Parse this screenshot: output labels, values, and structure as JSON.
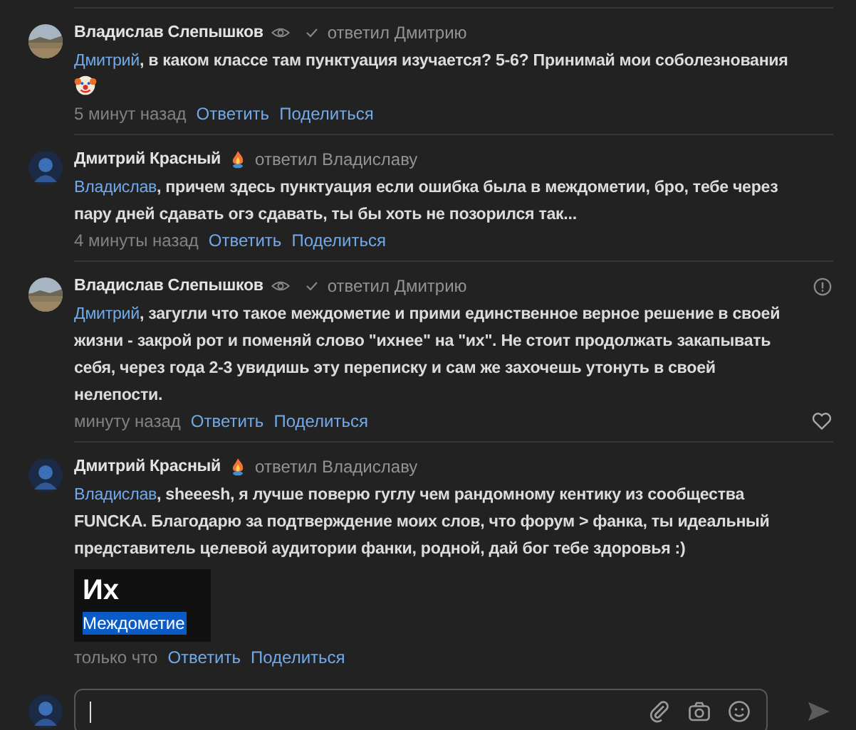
{
  "comments": [
    {
      "author": "Владислав Слепышков",
      "verified": true,
      "reply_to": "ответил Дмитрию",
      "mention": "Дмитрий",
      "text": ", в каком классе там пунктуация изучается? 5-6? Принимай мои соболезнования",
      "emoji": true,
      "time": "5 минут назад",
      "actions": [
        "Ответить",
        "Поделиться"
      ],
      "report": false,
      "like": false
    },
    {
      "author": "Дмитрий Красный",
      "verified": false,
      "reply_to": "ответил Владиславу",
      "mention": "Владислав",
      "text": ", причем здесь пунктуация если ошибка была в междометии, бро, тебе через пару дней сдавать огэ сдавать, ты бы хоть не позорился так...",
      "emoji": false,
      "time": "4 минуты назад",
      "actions": [
        "Ответить",
        "Поделиться"
      ],
      "report": false,
      "like": false
    },
    {
      "author": "Владислав Слепышков",
      "verified": true,
      "reply_to": "ответил Дмитрию",
      "mention": "Дмитрий",
      "text": ", загугли что такое междометие и прими единственное верное решение в своей жизни - закрой рот и поменяй слово \"ихнее\" на \"их\". Не стоит продолжать закапывать себя, через года 2-3 увидишь эту переписку и сам же захочешь утонуть в своей нелепости.",
      "emoji": false,
      "time": "минуту назад",
      "actions": [
        "Ответить",
        "Поделиться"
      ],
      "report": true,
      "like": true
    },
    {
      "author": "Дмитрий Красный",
      "verified": false,
      "reply_to": "ответил Владиславу",
      "mention": "Владислав",
      "text": ", sheeesh, я лучше поверю гуглу чем рандомному кентику из сообщества FUNCKA. Благодарю за подтверждение моих слов, что форум > фанка, ты идеальный представитель целевой аудитории фанки, родной, дай бог тебе здоровья :)",
      "emoji": false,
      "attachment": {
        "title": "Их",
        "highlighted": "Междометие"
      },
      "time": "только что",
      "actions": [
        "Ответить",
        "Поделиться"
      ],
      "report": false,
      "like": false
    }
  ]
}
